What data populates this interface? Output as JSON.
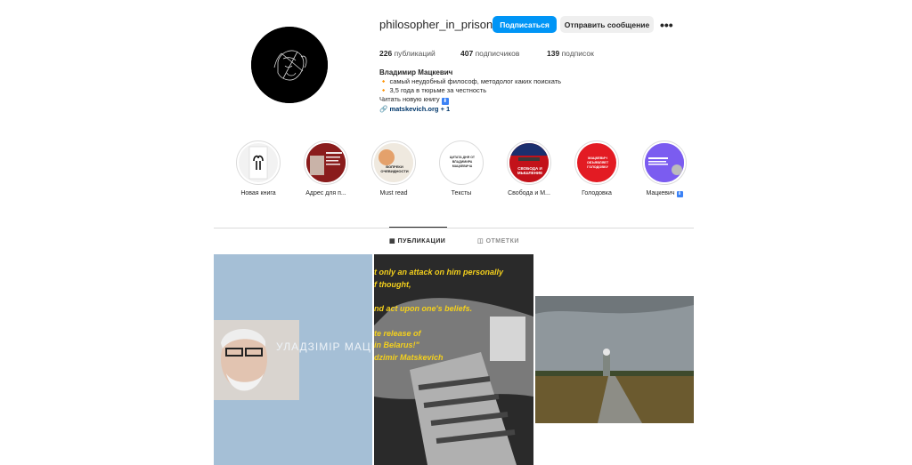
{
  "profile": {
    "username": "philosopher_in_prison",
    "follow_label": "Подписаться",
    "message_label": "Отправить сообщение",
    "more_label": "•••"
  },
  "stats": {
    "posts_count": "226",
    "posts_label": "публикаций",
    "followers_count": "407",
    "followers_label": "подписчиков",
    "following_count": "139",
    "following_label": "подписок"
  },
  "bio": {
    "name": "Владимир Мацкевич",
    "line1": "самый неудобный философ, методолог каких поискать",
    "line2": "3,5 года в тюрьме за честность",
    "line3": "Читать новую книгу",
    "link": "matskevich.org",
    "link_more": "+ 1"
  },
  "highlights": [
    {
      "label": "Новая книга"
    },
    {
      "label": "Адрес для п..."
    },
    {
      "label": "Must read",
      "cover_text": "ВОПРЕКИ ОЧЕВИДНОСТИ"
    },
    {
      "label": "Тексты",
      "cover_text": "ЦИТАТА ДНЯ ОТ ВЛАДИМИРА МАЦКЕВИЧА"
    },
    {
      "label": "Свобода и М...",
      "cover_text": "СВОБОДА И МЫШЛЕНИЕ"
    },
    {
      "label": "Голодовка",
      "cover_text": "МАЦКЕВИЧ ОБЪЯВЛЯЕТ ГОЛОДОВКУ"
    },
    {
      "label": "Мацкевич"
    }
  ],
  "tabs": {
    "posts": "ПУБЛИКАЦИИ",
    "tagged": "ОТМЕТКИ"
  },
  "posts": {
    "post1_text": "УЛАДЗІМІР МАЦКЕ",
    "post2_lines": [
      "t only an attack on him personally",
      "f thought,",
      "nd act upon one's beliefs.",
      "te release of",
      "in Belarus!\"",
      "dzimir Matskevich"
    ]
  },
  "colors": {
    "accent": "#0095f6",
    "link": "#00376b",
    "post_quote_text": "#f4d01c"
  }
}
